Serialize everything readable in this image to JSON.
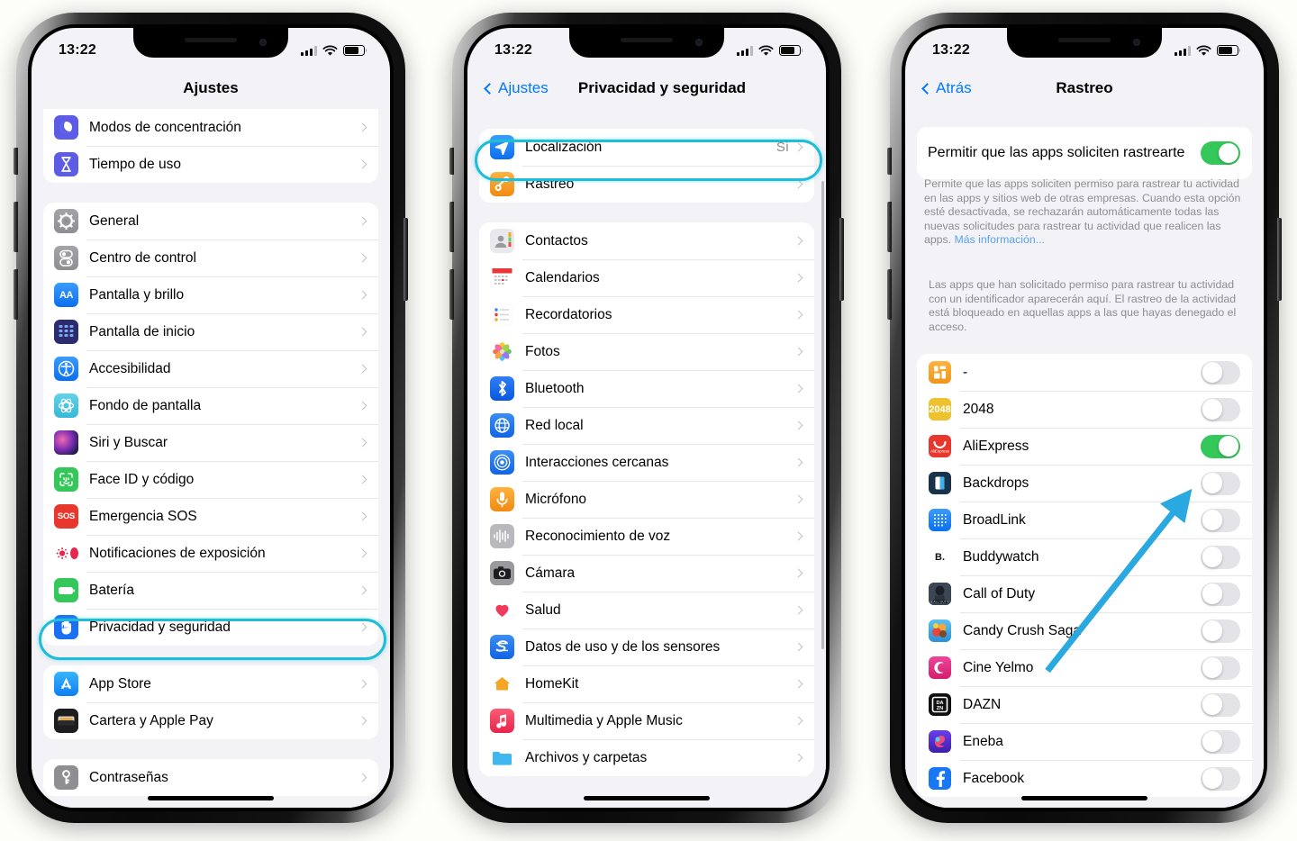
{
  "common": {
    "status_time": "13:22",
    "icons": {
      "signal": "signal-bars-icon",
      "wifi": "wifi-icon",
      "battery": "battery-icon"
    },
    "highlight_color": "#1fbdd8",
    "accent_blue": "#007aff",
    "toggle_on_color": "#34c759"
  },
  "phone1": {
    "title": "Ajustes",
    "groups": [
      {
        "items": [
          {
            "label": "Modos de concentración",
            "icon": "focus-moon-icon",
            "icon_class": "ic-moon",
            "glyph": ""
          },
          {
            "label": "Tiempo de uso",
            "icon": "hourglass-icon",
            "icon_class": "ic-hour",
            "glyph": "⌛"
          }
        ]
      },
      {
        "items": [
          {
            "label": "General",
            "icon": "gear-icon",
            "icon_class": "ic-gear",
            "glyph": "⚙"
          },
          {
            "label": "Centro de control",
            "icon": "control-center-icon",
            "icon_class": "ic-ctrl",
            "glyph": ""
          },
          {
            "label": "Pantalla y brillo",
            "icon": "display-brightness-icon",
            "icon_class": "ic-aa",
            "glyph": "AA"
          },
          {
            "label": "Pantalla de inicio",
            "icon": "home-screen-icon",
            "icon_class": "ic-home",
            "glyph": ""
          },
          {
            "label": "Accesibilidad",
            "icon": "accessibility-icon",
            "icon_class": "ic-acc",
            "glyph": ""
          },
          {
            "label": "Fondo de pantalla",
            "icon": "wallpaper-icon",
            "icon_class": "ic-wall",
            "glyph": ""
          },
          {
            "label": "Siri y Buscar",
            "icon": "siri-icon",
            "icon_class": "ic-siri",
            "glyph": ""
          },
          {
            "label": "Face ID y código",
            "icon": "face-id-icon",
            "icon_class": "ic-face",
            "glyph": ""
          },
          {
            "label": "Emergencia SOS",
            "icon": "sos-icon",
            "icon_class": "ic-sos",
            "glyph": "SOS"
          },
          {
            "label": "Notificaciones de exposición",
            "icon": "exposure-notifications-icon",
            "icon_class": "ic-expo",
            "glyph": ""
          },
          {
            "label": "Batería",
            "icon": "battery-settings-icon",
            "icon_class": "ic-batt",
            "glyph": ""
          },
          {
            "label": "Privacidad y seguridad",
            "icon": "privacy-hand-icon",
            "icon_class": "ic-priv",
            "glyph": "",
            "highlighted": true
          }
        ]
      },
      {
        "items": [
          {
            "label": "App Store",
            "icon": "app-store-icon",
            "icon_class": "ic-appstore",
            "glyph": ""
          },
          {
            "label": "Cartera y Apple Pay",
            "icon": "wallet-icon",
            "icon_class": "ic-wallet",
            "glyph": ""
          }
        ]
      },
      {
        "items": [
          {
            "label": "Contraseñas",
            "icon": "key-icon",
            "icon_class": "ic-key",
            "glyph": ""
          }
        ]
      }
    ]
  },
  "phone2": {
    "back_label": "Ajustes",
    "title": "Privacidad y seguridad",
    "groups": [
      {
        "items": [
          {
            "label": "Localización",
            "value": "Sí",
            "icon": "location-arrow-icon",
            "icon_class": "ic-loc",
            "glyph": ""
          },
          {
            "label": "Rastreo",
            "icon": "tracking-icon",
            "icon_class": "ic-track",
            "glyph": "",
            "highlighted": true
          }
        ]
      },
      {
        "items": [
          {
            "label": "Contactos",
            "icon": "contacts-icon",
            "icon_class": "ic-cont",
            "glyph": ""
          },
          {
            "label": "Calendarios",
            "icon": "calendar-icon",
            "icon_class": "ic-cal",
            "glyph": ""
          },
          {
            "label": "Recordatorios",
            "icon": "reminders-icon",
            "icon_class": "ic-rem",
            "glyph": ""
          },
          {
            "label": "Fotos",
            "icon": "photos-icon",
            "icon_class": "ic-fotos",
            "glyph": ""
          },
          {
            "label": "Bluetooth",
            "icon": "bluetooth-icon",
            "icon_class": "ic-bt",
            "glyph": ""
          },
          {
            "label": "Red local",
            "icon": "local-network-icon",
            "icon_class": "ic-net",
            "glyph": ""
          },
          {
            "label": "Interacciones cercanas",
            "icon": "nearby-interactions-icon",
            "icon_class": "ic-near",
            "glyph": ""
          },
          {
            "label": "Micrófono",
            "icon": "microphone-icon",
            "icon_class": "ic-mic",
            "glyph": ""
          },
          {
            "label": "Reconocimiento de voz",
            "icon": "speech-recognition-icon",
            "icon_class": "ic-voz",
            "glyph": ""
          },
          {
            "label": "Cámara",
            "icon": "camera-icon",
            "icon_class": "ic-cam",
            "glyph": ""
          },
          {
            "label": "Salud",
            "icon": "health-heart-icon",
            "icon_class": "ic-salud",
            "glyph": ""
          },
          {
            "label": "Datos de uso y de los sensores",
            "icon": "sensor-data-icon",
            "icon_class": "ic-sens",
            "glyph": ""
          },
          {
            "label": "HomeKit",
            "icon": "homekit-icon",
            "icon_class": "ic-hk",
            "glyph": ""
          },
          {
            "label": "Multimedia y Apple Music",
            "icon": "apple-music-icon",
            "icon_class": "ic-music",
            "glyph": ""
          },
          {
            "label": "Archivos y carpetas",
            "icon": "files-folder-icon",
            "icon_class": "ic-files",
            "glyph": ""
          }
        ]
      }
    ]
  },
  "phone3": {
    "back_label": "Atrás",
    "title": "Rastreo",
    "master_toggle": {
      "label": "Permitir que las apps soliciten rastrearte",
      "state": "on"
    },
    "footnote1_text": "Permite que las apps soliciten permiso para rastrear tu actividad en las apps y sitios web de otras empresas. Cuando esta opción esté desactivada, se rechazarán automáticamente todas las nuevas solicitudes para rastrear tu actividad que realicen las apps. ",
    "footnote1_link": "Más información...",
    "footnote2": "Las apps que han solicitado permiso para rastrear tu actividad con un identificador aparecerán aquí. El rastreo de la actividad está bloqueado en aquellas apps a las que hayas denegado el acceso.",
    "apps": [
      {
        "label": "-",
        "icon": "dash-app-icon",
        "icon_class": "ic-dash",
        "glyph": "",
        "state": "off"
      },
      {
        "label": "2048",
        "icon": "2048-app-icon",
        "icon_class": "ic-2048",
        "glyph": "2048",
        "state": "off"
      },
      {
        "label": "AliExpress",
        "icon": "aliexpress-app-icon",
        "icon_class": "ic-ali",
        "glyph": "",
        "state": "on"
      },
      {
        "label": "Backdrops",
        "icon": "backdrops-app-icon",
        "icon_class": "ic-back",
        "glyph": "",
        "state": "off"
      },
      {
        "label": "BroadLink",
        "icon": "broadlink-app-icon",
        "icon_class": "ic-broad",
        "glyph": "",
        "state": "off"
      },
      {
        "label": "Buddywatch",
        "icon": "buddywatch-app-icon",
        "icon_class": "ic-buddy",
        "glyph": "B.",
        "state": "off"
      },
      {
        "label": "Call of Duty",
        "icon": "call-of-duty-app-icon",
        "icon_class": "ic-cod",
        "glyph": "",
        "state": "off"
      },
      {
        "label": "Candy Crush Saga",
        "icon": "candy-crush-app-icon",
        "icon_class": "ic-candy",
        "glyph": "",
        "state": "off"
      },
      {
        "label": "Cine Yelmo",
        "icon": "cine-yelmo-app-icon",
        "icon_class": "ic-cine",
        "glyph": "",
        "state": "off"
      },
      {
        "label": "DAZN",
        "icon": "dazn-app-icon",
        "icon_class": "ic-dazn",
        "glyph": "DA ZN",
        "state": "off"
      },
      {
        "label": "Eneba",
        "icon": "eneba-app-icon",
        "icon_class": "ic-eneba",
        "glyph": "",
        "state": "off"
      },
      {
        "label": "Facebook",
        "icon": "facebook-app-icon",
        "icon_class": "ic-fb",
        "glyph": "f",
        "state": "off"
      }
    ],
    "annotation_arrow": "arrow-pointing-to-aliexpress-toggle"
  }
}
